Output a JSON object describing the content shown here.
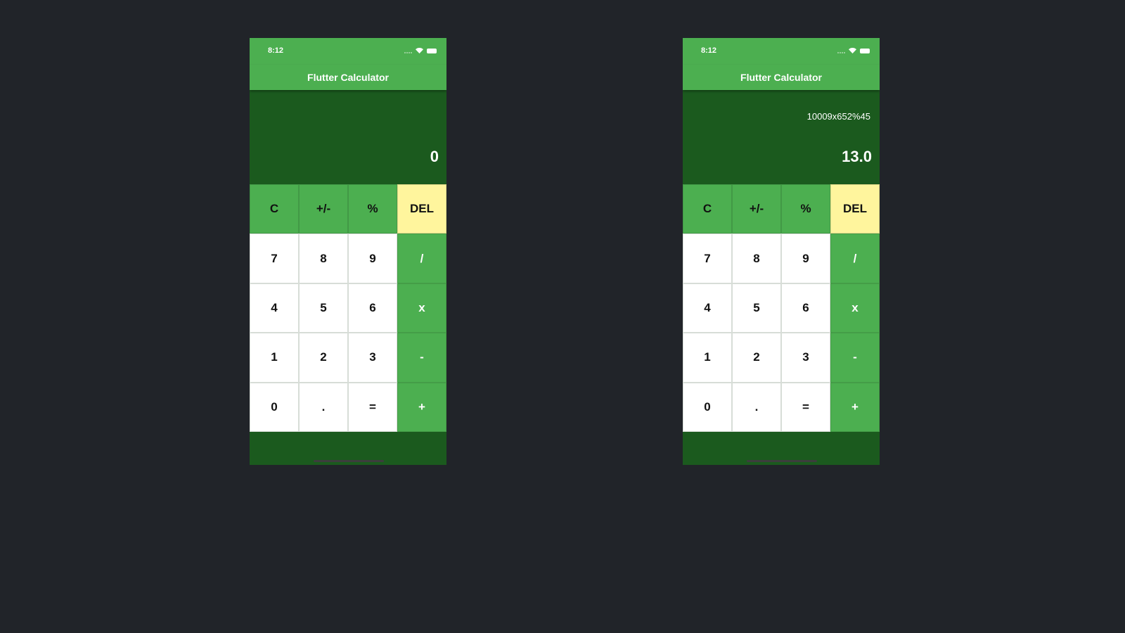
{
  "screens": [
    {
      "status_time": "8:12",
      "title": "Flutter Calculator",
      "expression": "",
      "result": "0",
      "keys": [
        "C",
        "+/-",
        "%",
        "DEL",
        "7",
        "8",
        "9",
        "/",
        "4",
        "5",
        "6",
        "x",
        "1",
        "2",
        "3",
        "-",
        "0",
        ".",
        "=",
        "+"
      ]
    },
    {
      "status_time": "8:12",
      "title": "Flutter Calculator",
      "expression": "10009x652%45",
      "result": "13.0",
      "keys": [
        "C",
        "+/-",
        "%",
        "DEL",
        "7",
        "8",
        "9",
        "/",
        "4",
        "5",
        "6",
        "x",
        "1",
        "2",
        "3",
        "-",
        "0",
        ".",
        "=",
        "+"
      ]
    }
  ],
  "icons": [
    "signal-icon",
    "wifi-icon",
    "battery-icon"
  ],
  "colors": {
    "background": "#212429",
    "primary": "#4caf50",
    "display": "#1b5a1e",
    "del_key": "#fff59d",
    "number_key": "#ffffff"
  }
}
